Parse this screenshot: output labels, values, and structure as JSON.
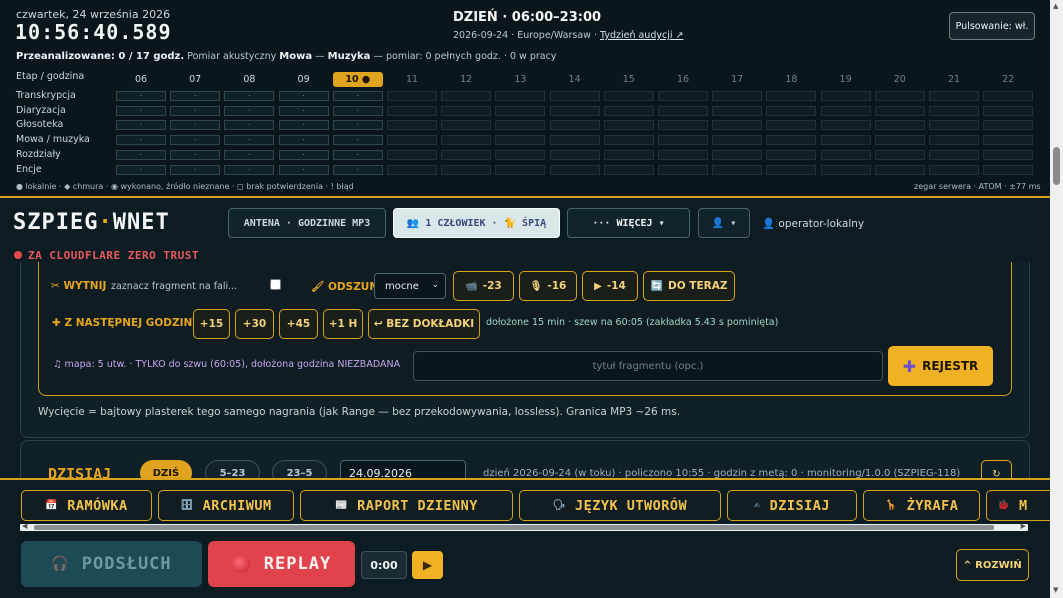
{
  "status": {
    "date_line": "czwartek, 24 września 2026",
    "clock": "10:56:40.589",
    "day_title": "DZIEŃ · 06:00–23:00",
    "day_sub_prefix": "2026-09-24 · Europe/Warsaw · ",
    "day_sub_link": "Tydzień audycji ↗",
    "pulse_button": "Pulsowanie: wł.",
    "analysis_bold": "Przeanalizowane: 0 / 17 godz.",
    "analysis_mid": " Pomiar akustyczny ",
    "analysis_mowa": "Mowa",
    "analysis_sep": " — ",
    "analysis_muzyka": "Muzyka",
    "analysis_rest": " — pomiar: 0 pełnych godz. · 0 w pracy",
    "grid_label": "Etap / godzina",
    "hours": [
      "06",
      "07",
      "08",
      "09",
      "10 ●",
      "11",
      "12",
      "13",
      "14",
      "15",
      "16",
      "17",
      "18",
      "19",
      "20",
      "21",
      "22"
    ],
    "current_hour_index": 4,
    "rows": [
      "Transkrypcja",
      "Diaryzacja",
      "Głosoteka",
      "Mowa / muzyka",
      "Rozdziały",
      "Encje"
    ],
    "cell_mark": "·",
    "legend": "● lokalnie · ◆ chmura · ◉ wykonano, źródło nieznane · ◻ brak potwierdzenia · ! błąd",
    "server_clock": "zegar serwera · ATOM · ±77 ms"
  },
  "header": {
    "logo_a": "SZPIEG",
    "logo_dot": "·",
    "logo_b": "WNET",
    "zero_trust": "ZA CLOUDFLARE ZERO TRUST",
    "antena": "ANTENA · GODZINNE MP3",
    "people": "👥 1 CZŁOWIEK · 🐈 ŚPIĄ",
    "more": "··· WIĘCEJ ▾",
    "user_menu": "👤 ▾",
    "operator": "👤 operator-lokalny"
  },
  "tools": {
    "cut_label": "✂ WYTNIJ",
    "cut_note": "zaznacz fragment na fali...",
    "odszum_label": "🖌 ODSZUM",
    "odszum_value": "mocne",
    "btn_m23": "-23",
    "btn_m16": "-16",
    "btn_m14": "-14",
    "btn_doteraz": "DO TERAZ",
    "next_label": "✚ Z NASTĘPNEJ GODZINY:",
    "btn_15": "+15",
    "btn_30": "+30",
    "btn_45": "+45",
    "btn_1h": "+1 H",
    "btn_bez": "↩ BEZ DOKŁADKI",
    "next_note": "dołożone 15 min · szew na 60:05 (zakładka 5.43 s pominięta)",
    "map_note": "♫ mapa: 5 utw. · TYLKO do szwu (60:05), dołożona godzina NIEZBADANA",
    "title_placeholder": "tytuł fragmentu (opc.)",
    "rejestr": "REJESTR",
    "doc_note": "Wycięcie = bajtowy plasterek tego samego nagrania (jak Range — bez przekodowywania, lossless). Granica MP3 ~26 ms."
  },
  "today": {
    "title": "DZISIAJ",
    "chip_dzis": "DZIŚ",
    "chip_523": "5–23",
    "chip_235": "23–5",
    "date_value": "24.09.2026",
    "meta": "dzień 2026-09-24 (w toku) · policzono 10:55 · godzin z metą: 0 · monitoring/1.0.0 (SZPIEG-118)"
  },
  "nav": {
    "items": [
      "RAMÓWKA",
      "ARCHIWUM",
      "RAPORT DZIENNY",
      "JĘZYK UTWORÓW",
      "DZISIAJ",
      "ŻYRAFA",
      "M"
    ]
  },
  "player": {
    "podsluch": "PODSŁUCH",
    "replay": "REPLAY",
    "time": "0:00",
    "play": "▶",
    "rozwin": "^ ROZWIŃ"
  },
  "colors": {
    "accent": "#e0a320",
    "danger": "#e0434c",
    "bg": "#0d1b22"
  }
}
